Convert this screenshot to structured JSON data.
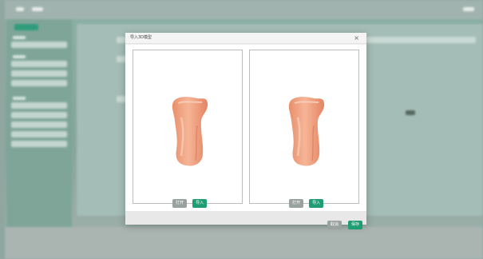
{
  "dialog": {
    "title": "导入3D模型",
    "close_glyph": "×",
    "panels": [
      {
        "open_label": "打开",
        "import_label": "导入"
      },
      {
        "open_label": "打开",
        "import_label": "导入"
      }
    ],
    "cancel_label": "取消",
    "save_label": "保存"
  },
  "colors": {
    "accent": "#1e9e72",
    "secondary_button": "#9aa29f",
    "model_skin": "#f0a07e"
  }
}
